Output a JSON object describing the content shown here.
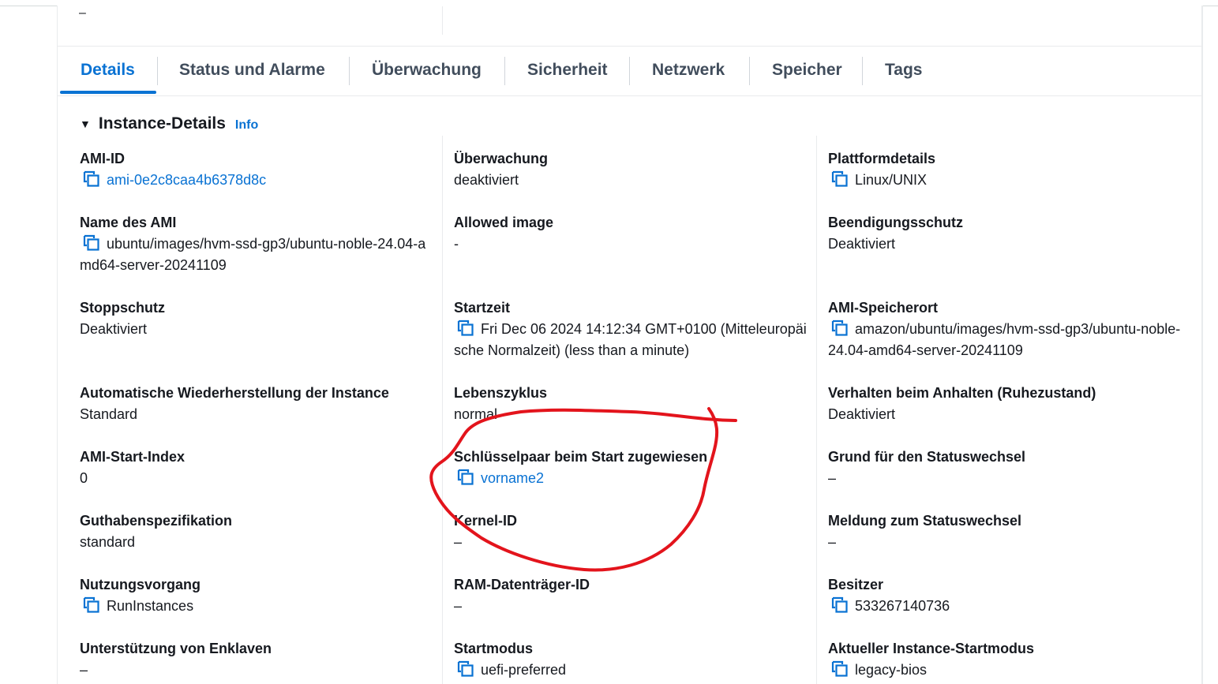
{
  "previous_row": {
    "value": "–"
  },
  "tabs": [
    {
      "label": "Details",
      "active": true
    },
    {
      "label": "Status und Alarme"
    },
    {
      "label": "Überwachung"
    },
    {
      "label": "Sicherheit"
    },
    {
      "label": "Netzwerk"
    },
    {
      "label": "Speicher"
    },
    {
      "label": "Tags"
    }
  ],
  "section": {
    "title": "Instance-Details",
    "info": "Info"
  },
  "fields": {
    "ami_id": {
      "label": "AMI-ID",
      "value": "ami-0e2c8caa4b6378d8c"
    },
    "ami_name": {
      "label": "Name des AMI",
      "value": "ubuntu/images/hvm-ssd-gp3/ubuntu-noble-24.04-amd64-server-20241109"
    },
    "stop_protection": {
      "label": "Stoppschutz",
      "value": "Deaktiviert"
    },
    "auto_recovery": {
      "label": "Automatische Wiederherstellung der Instance",
      "value": "Standard"
    },
    "ami_launch_index": {
      "label": "AMI-Start-Index",
      "value": "0"
    },
    "credit_spec": {
      "label": "Guthabenspezifikation",
      "value": "standard"
    },
    "usage_operation": {
      "label": "Nutzungsvorgang",
      "value": "RunInstances"
    },
    "enclave_support": {
      "label": "Unterstützung von Enklaven",
      "value": "–"
    },
    "monitoring": {
      "label": "Überwachung",
      "value": "deaktiviert"
    },
    "allowed_image": {
      "label": "Allowed image",
      "value": "-"
    },
    "launch_time": {
      "label": "Startzeit",
      "value": "Fri Dec 06 2024 14:12:34 GMT+0100 (Mitteleuropäische Normalzeit) (less than a minute)"
    },
    "lifecycle": {
      "label": "Lebenszyklus",
      "value": "normal"
    },
    "key_pair": {
      "label": "Schlüsselpaar beim Start zugewiesen",
      "value": "vorname2"
    },
    "kernel_id": {
      "label": "Kernel-ID",
      "value": "–"
    },
    "ramdisk_id": {
      "label": "RAM-Datenträger-ID",
      "value": "–"
    },
    "boot_mode": {
      "label": "Startmodus",
      "value": "uefi-preferred"
    },
    "platform_details": {
      "label": "Plattformdetails",
      "value": "Linux/UNIX"
    },
    "termination_protection": {
      "label": "Beendigungsschutz",
      "value": "Deaktiviert"
    },
    "ami_location": {
      "label": "AMI-Speicherort",
      "value": "amazon/ubuntu/images/hvm-ssd-gp3/ubuntu-noble-24.04-amd64-server-20241109"
    },
    "stop_hibernate": {
      "label": "Verhalten beim Anhalten (Ruhezustand)",
      "value": "Deaktiviert"
    },
    "state_reason": {
      "label": "Grund für den Statuswechsel",
      "value": "–"
    },
    "state_message": {
      "label": "Meldung zum Statuswechsel",
      "value": "–"
    },
    "owner": {
      "label": "Besitzer",
      "value": "533267140736"
    },
    "current_boot_mode": {
      "label": "Aktueller Instance-Startmodus",
      "value": "legacy-bios"
    }
  },
  "colors": {
    "link": "#0972d3",
    "text": "#16191f",
    "annotation": "#e3141c"
  }
}
